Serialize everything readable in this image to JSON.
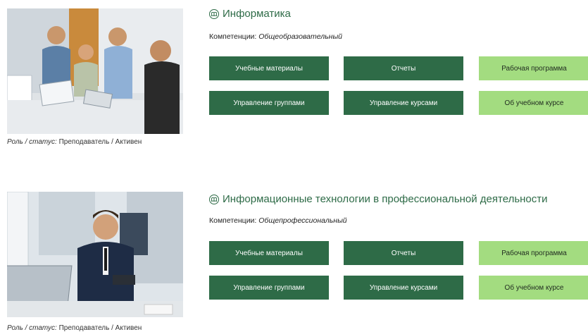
{
  "courses": [
    {
      "title": "Информатика",
      "competencies_label": "Компетенции:",
      "competencies_value": "Общеобразовательный",
      "role_label": "Роль / статус:",
      "role_value": "Преподаватель / Активен",
      "buttons": {
        "materials": "Учебные материалы",
        "reports": "Отчеты",
        "program": "Рабочая программа",
        "groups": "Управление группами",
        "courses": "Управление курсами",
        "about": "Об учебном курсе"
      }
    },
    {
      "title": "Информационные технологии в профессиональной деятельности",
      "competencies_label": "Компетенции:",
      "competencies_value": "Общепрофессиональный",
      "role_label": "Роль / статус:",
      "role_value": "Преподаватель / Активен",
      "buttons": {
        "materials": "Учебные материалы",
        "reports": "Отчеты",
        "program": "Рабочая программа",
        "groups": "Управление группами",
        "courses": "Управление курсами",
        "about": "Об учебном курсе"
      }
    }
  ],
  "colors": {
    "primary_dark_green": "#2e6b47",
    "light_green": "#a3dc80",
    "title_green": "#2e6b47"
  },
  "icons": {
    "course_title_icon": "book-circle-icon"
  }
}
